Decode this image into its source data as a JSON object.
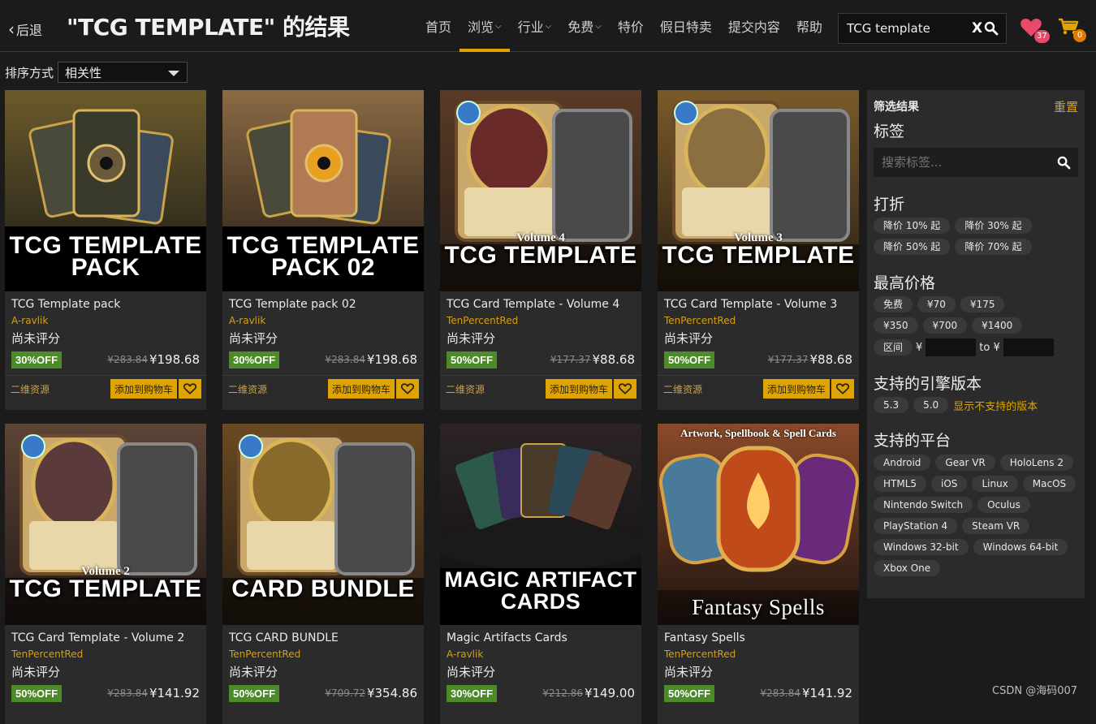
{
  "header": {
    "back_label": "后退",
    "title": "\"TCG TEMPLATE\" 的结果",
    "nav": [
      {
        "label": "首页",
        "dropdown": false,
        "active": false
      },
      {
        "label": "浏览",
        "dropdown": true,
        "active": true
      },
      {
        "label": "行业",
        "dropdown": true,
        "active": false
      },
      {
        "label": "免费",
        "dropdown": true,
        "active": false
      },
      {
        "label": "特价",
        "dropdown": false,
        "active": false
      },
      {
        "label": "假日特卖",
        "dropdown": false,
        "active": false
      },
      {
        "label": "提交内容",
        "dropdown": false,
        "active": false
      },
      {
        "label": "帮助",
        "dropdown": false,
        "active": false
      }
    ],
    "search_value": "TCG template",
    "clear_label": "X",
    "wishlist_count": "37",
    "cart_count": "0",
    "accent": "#e0a400",
    "wishlist_color": "#e84b6a"
  },
  "sort": {
    "label": "排序方式",
    "value": "相关性"
  },
  "products": [
    {
      "name": "TCG Template pack",
      "publisher": "A-ravlik",
      "rating": "尚未评分",
      "discount": "30%OFF",
      "original": "¥283.84",
      "price": "¥198.68",
      "qr": "二维资源",
      "cart": "添加到购物车",
      "caption": "TCG TEMPLATE|PACK",
      "subcaption": "",
      "theme": "pack"
    },
    {
      "name": "TCG Template pack 02",
      "publisher": "A-ravlik",
      "rating": "尚未评分",
      "discount": "30%OFF",
      "original": "¥283.84",
      "price": "¥198.68",
      "qr": "二维资源",
      "cart": "添加到购物车",
      "caption": "TCG TEMPLATE|PACK 02",
      "subcaption": "",
      "theme": "pack2"
    },
    {
      "name": "TCG Card Template - Volume 4",
      "publisher": "TenPercentRed",
      "rating": "尚未评分",
      "discount": "50%OFF",
      "original": "¥177.37",
      "price": "¥88.68",
      "qr": "二维资源",
      "cart": "添加到购物车",
      "caption": "TCG TEMPLATE",
      "subcaption": "Volume 4",
      "theme": "vol4"
    },
    {
      "name": "TCG Card Template - Volume 3",
      "publisher": "TenPercentRed",
      "rating": "尚未评分",
      "discount": "50%OFF",
      "original": "¥177.37",
      "price": "¥88.68",
      "qr": "二维资源",
      "cart": "添加到购物车",
      "caption": "TCG TEMPLATE",
      "subcaption": "Volume 3",
      "theme": "vol3"
    },
    {
      "name": "TCG Card Template - Volume 2",
      "publisher": "TenPercentRed",
      "rating": "尚未评分",
      "discount": "50%OFF",
      "original": "¥283.84",
      "price": "¥141.92",
      "qr": "",
      "cart": "",
      "caption": "TCG TEMPLATE",
      "subcaption": "Volume 2",
      "theme": "vol2"
    },
    {
      "name": "TCG CARD BUNDLE",
      "publisher": "TenPercentRed",
      "rating": "尚未评分",
      "discount": "50%OFF",
      "original": "¥709.72",
      "price": "¥354.86",
      "qr": "",
      "cart": "",
      "caption": "CARD BUNDLE",
      "subcaption": "",
      "theme": "bundle"
    },
    {
      "name": "Magic Artifacts Cards",
      "publisher": "A-ravlik",
      "rating": "尚未评分",
      "discount": "30%OFF",
      "original": "¥212.86",
      "price": "¥149.00",
      "qr": "",
      "cart": "",
      "caption": "MAGIC ARTIFACT|CARDS",
      "subcaption": "",
      "theme": "magic"
    },
    {
      "name": "Fantasy Spells",
      "publisher": "TenPercentRed",
      "rating": "尚未评分",
      "discount": "50%OFF",
      "original": "¥283.84",
      "price": "¥141.92",
      "qr": "",
      "cart": "",
      "caption": "Fantasy Spells",
      "subcaption": "Artwork, Spellbook & Spell Cards",
      "theme": "spells"
    }
  ],
  "filters": {
    "title": "筛选结果",
    "reset": "重置",
    "tags_title": "标签",
    "tag_search_placeholder": "搜索标签...",
    "discount_title": "打折",
    "discounts": [
      "降价 10% 起",
      "降价 30% 起",
      "降价 50% 起",
      "降价 70% 起"
    ],
    "price_title": "最高价格",
    "prices": [
      "免费",
      "¥70",
      "¥175",
      "¥350",
      "¥700",
      "¥1400"
    ],
    "range_label": "区间",
    "range_currency": "¥",
    "range_to": "to ¥",
    "engine_title": "支持的引擎版本",
    "engines": [
      "5.3",
      "5.0"
    ],
    "show_unsupported": "显示不支持的版本",
    "platform_title": "支持的平台",
    "platforms": [
      "Android",
      "Gear VR",
      "HoloLens 2",
      "HTML5",
      "iOS",
      "Linux",
      "MacOS",
      "Nintendo Switch",
      "Oculus",
      "PlayStation 4",
      "Steam VR",
      "Windows 32-bit",
      "Windows 64-bit",
      "Xbox One"
    ]
  },
  "watermark": "CSDN @海码007"
}
